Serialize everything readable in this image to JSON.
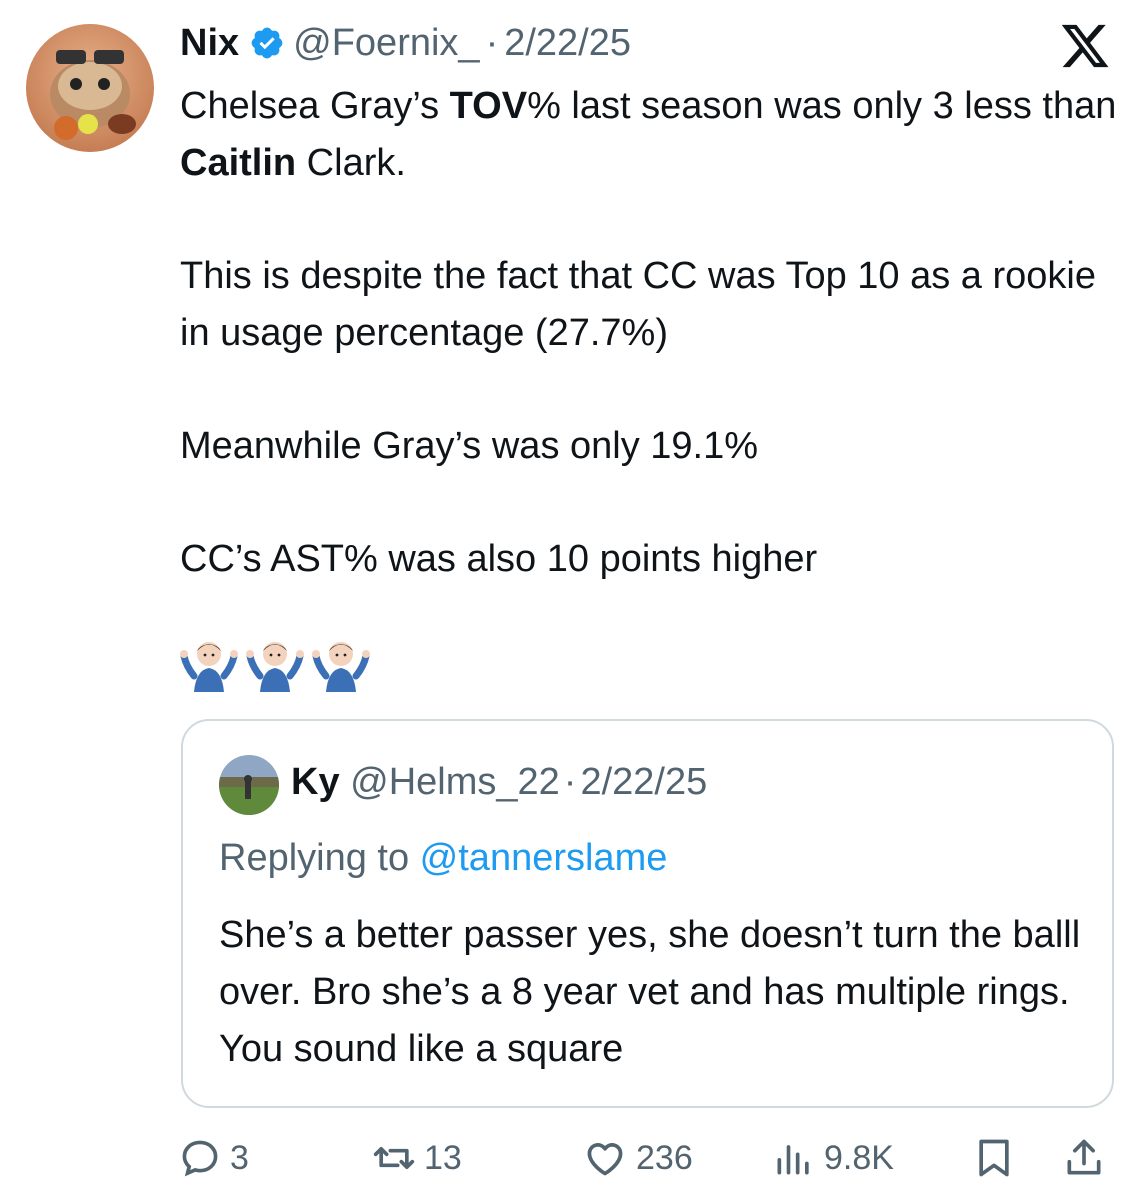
{
  "tweet": {
    "author_name": "Nix",
    "handle": "@Foernix_",
    "separator": "·",
    "date": "2/22/25",
    "paragraphs": [
      {
        "segments": [
          "Chelsea Gray’s ",
          "TOV",
          "% last season was only 3 less than ",
          "Caitlin",
          " Clark."
        ]
      },
      {
        "text": "This is despite the fact that CC was Top 10 as a rookie in usage percentage (27.7%)"
      },
      {
        "text": "Meanwhile Gray’s was only 19.1%"
      },
      {
        "text": "CC’s AST% was also 10 points higher"
      }
    ],
    "emoji": "🤷🏻‍♂️🤷🏻‍♂️🤷🏻‍♂️"
  },
  "quoted": {
    "author_name": "Ky",
    "handle": "@Helms_22",
    "separator": "·",
    "date": "2/22/25",
    "replying_prefix": "Replying to ",
    "replying_to": "@tannerslame",
    "text": "She’s a better passer yes, she doesn’t turn the balll over. Bro she’s a 8 year vet and has multiple rings. You sound like a square"
  },
  "actions": {
    "replies": "3",
    "reposts": "13",
    "likes": "236",
    "views": "9.8K"
  },
  "colors": {
    "text": "#0f1419",
    "muted": "#536471",
    "link": "#1d9bf0",
    "verified": "#1d9bf0",
    "border": "#cfd9de"
  },
  "icons": [
    "verified-badge-icon",
    "x-logo-icon",
    "reply-icon",
    "repost-icon",
    "like-icon",
    "views-icon",
    "bookmark-icon",
    "share-icon"
  ]
}
